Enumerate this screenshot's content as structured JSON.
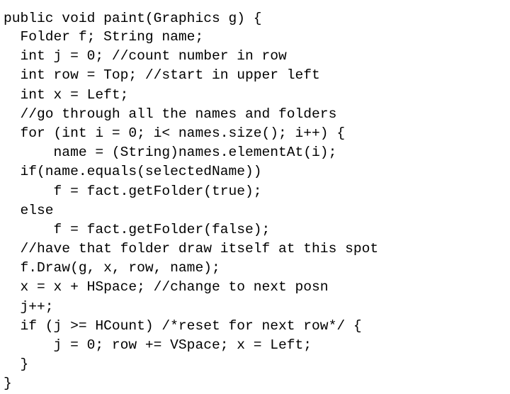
{
  "document": {
    "kind": "code-listing",
    "language": "Java",
    "background_color": "#ffffff",
    "text_color": "#000000",
    "lines": [
      "public void paint(Graphics g) {",
      "  Folder f; String name;",
      "  int j = 0; //count number in row",
      "  int row = Top; //start in upper left",
      "  int x = Left;",
      "  //go through all the names and folders",
      "  for (int i = 0; i< names.size(); i++) {",
      "      name = (String)names.elementAt(i);",
      "  if(name.equals(selectedName))",
      "      f = fact.getFolder(true);",
      "  else",
      "      f = fact.getFolder(false);",
      "  //have that folder draw itself at this spot",
      "  f.Draw(g, x, row, name);",
      "  x = x + HSpace; //change to next posn",
      "  j++;",
      "  if (j >= HCount) /*reset for next row*/ {",
      "      j = 0; row += VSpace; x = Left;",
      "  }",
      "}"
    ]
  }
}
